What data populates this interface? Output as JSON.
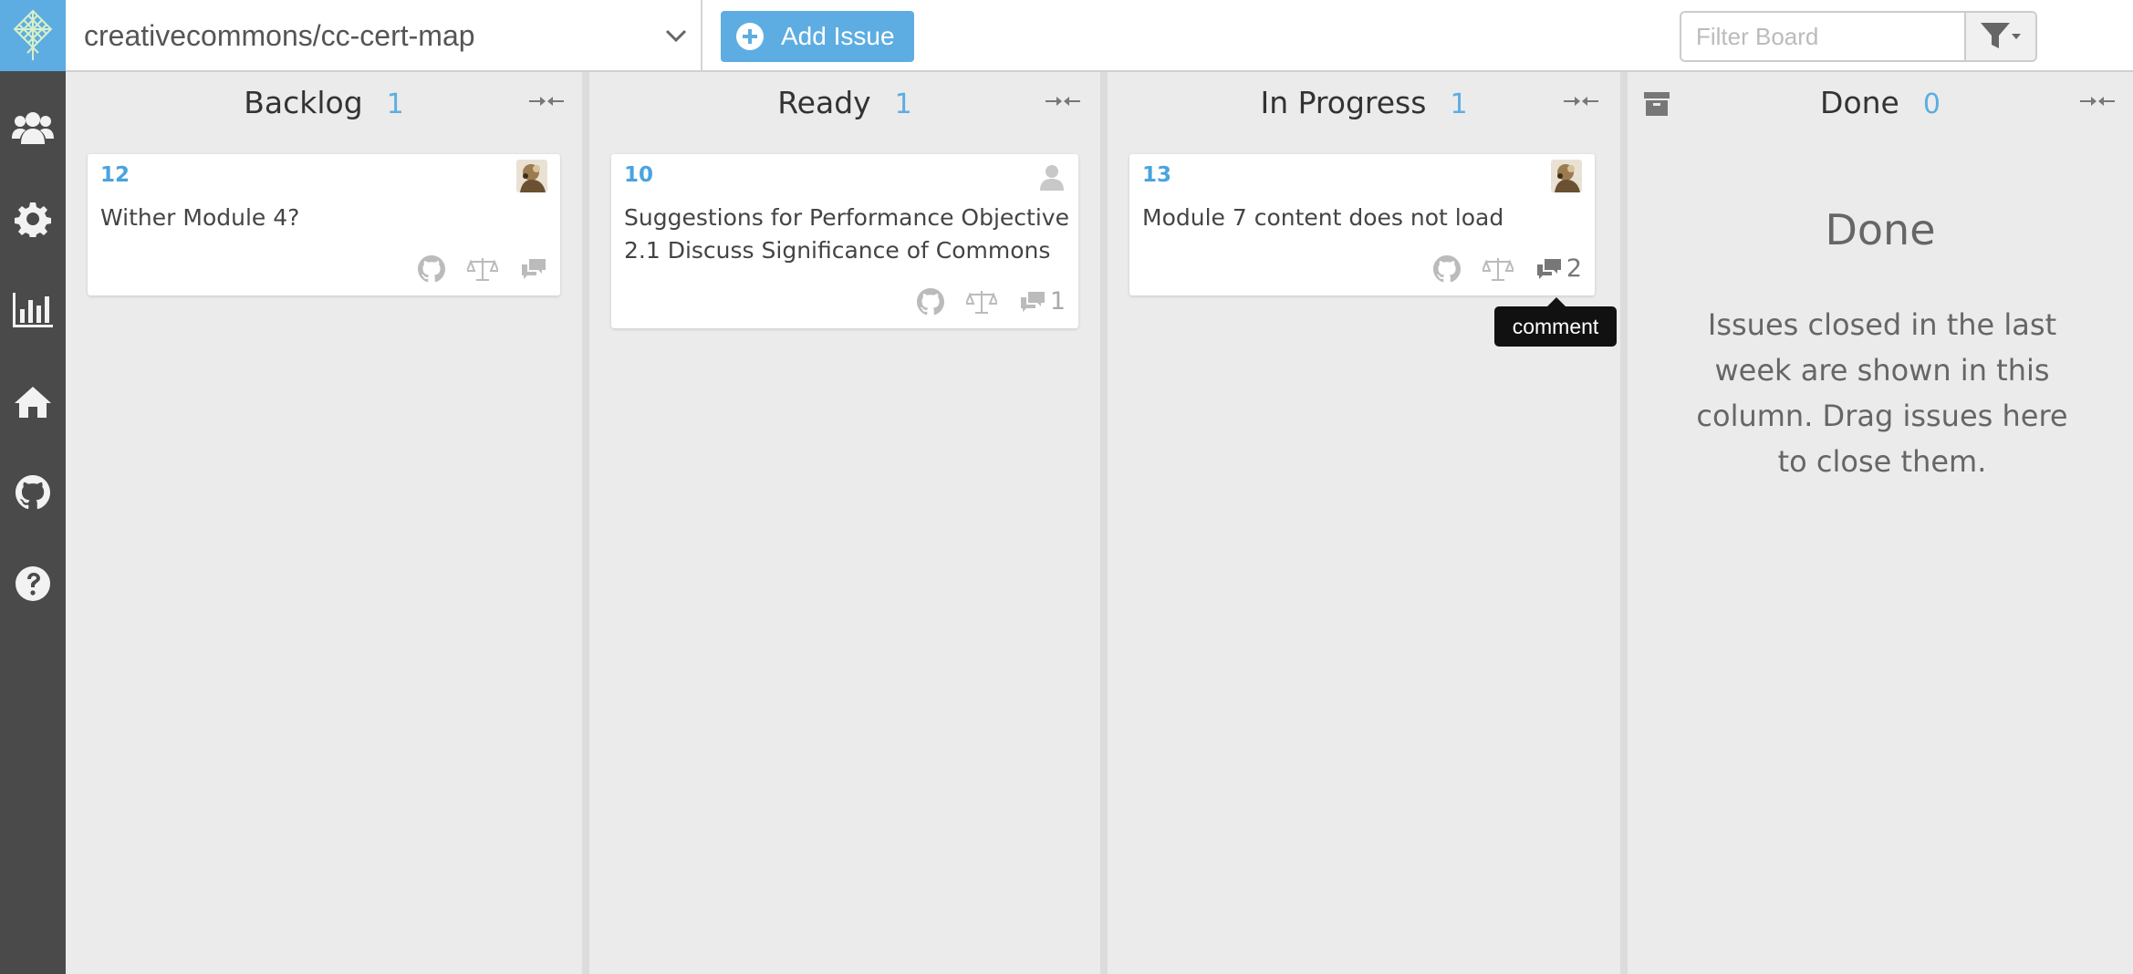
{
  "sidebar": {
    "logo": "cc-logo-icon",
    "items": [
      {
        "icon": "team-icon"
      },
      {
        "icon": "gear-icon"
      },
      {
        "icon": "bar-chart-icon"
      },
      {
        "icon": "home-icon"
      },
      {
        "icon": "github-icon"
      },
      {
        "icon": "help-icon"
      }
    ]
  },
  "topbar": {
    "repo": "creativecommons/cc-cert-map",
    "add_issue_label": "Add Issue",
    "filter_placeholder": "Filter Board"
  },
  "columns": [
    {
      "title": "Backlog",
      "count": "1",
      "cards": [
        {
          "number": "12",
          "title": "Wither Module 4?",
          "comments": "",
          "assignee": "avatar"
        }
      ]
    },
    {
      "title": "Ready",
      "count": "1",
      "cards": [
        {
          "number": "10",
          "title_line1": "Suggestions for Performance Objective",
          "title_line2": "2.1 Discuss Significance of Commons",
          "comments": "1",
          "assignee": "unassigned"
        }
      ]
    },
    {
      "title": "In Progress",
      "count": "1",
      "cards": [
        {
          "number": "13",
          "title": "Module 7 content does not load",
          "comments": "2",
          "assignee": "avatar"
        }
      ]
    },
    {
      "title": "Done",
      "count": "0",
      "empty_heading": "Done",
      "empty_text": "Issues closed in the last week are shown in this column. Drag issues here to close them."
    }
  ],
  "tooltip": "comment",
  "colors": {
    "accent": "#5dade2",
    "sidebar": "#4a4a4a",
    "board": "#ebebeb"
  }
}
